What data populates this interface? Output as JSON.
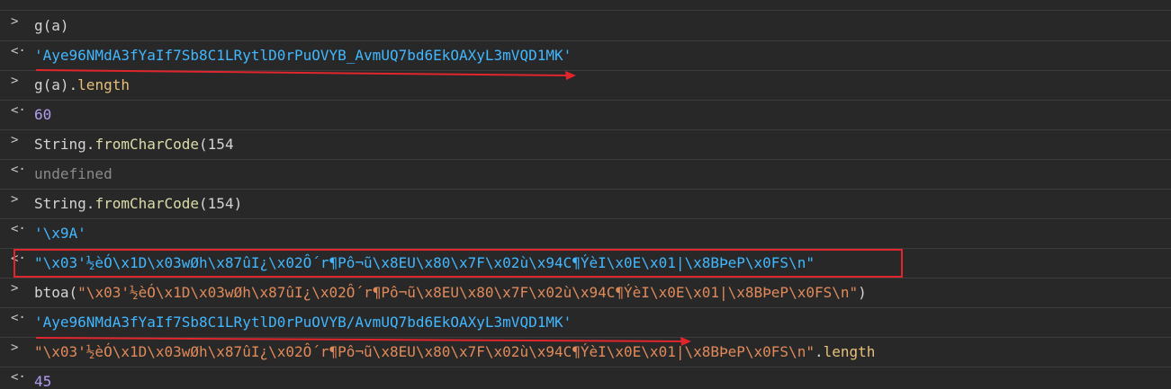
{
  "rows": [
    {
      "kind": "input",
      "parts": [
        {
          "t": "g(a)",
          "c": "plain"
        }
      ]
    },
    {
      "kind": "output",
      "parts": [
        {
          "t": "'Aye96NMdA3fYaIf7Sb8C1LRytlD0rPuOVYB_AvmUQ7bd6EkOAXyL3mVQD1MK'",
          "c": "strblue"
        }
      ]
    },
    {
      "kind": "input",
      "parts": [
        {
          "t": "g(a).",
          "c": "plain"
        },
        {
          "t": "length",
          "c": "prop"
        }
      ]
    },
    {
      "kind": "output",
      "parts": [
        {
          "t": "60",
          "c": "num"
        }
      ]
    },
    {
      "kind": "input",
      "parts": [
        {
          "t": "String.",
          "c": "plain"
        },
        {
          "t": "fromCharCode",
          "c": "fn"
        },
        {
          "t": "(",
          "c": "plain"
        },
        {
          "t": "154",
          "c": "plain"
        }
      ]
    },
    {
      "kind": "output",
      "parts": [
        {
          "t": "undefined",
          "c": "undef"
        }
      ]
    },
    {
      "kind": "input",
      "parts": [
        {
          "t": "String.",
          "c": "plain"
        },
        {
          "t": "fromCharCode",
          "c": "fn"
        },
        {
          "t": "(",
          "c": "plain"
        },
        {
          "t": "154",
          "c": "plain"
        },
        {
          "t": ")",
          "c": "plain"
        }
      ]
    },
    {
      "kind": "output",
      "parts": [
        {
          "t": "'\\x9A'",
          "c": "strblue"
        }
      ]
    },
    {
      "kind": "output",
      "parts": [
        {
          "t": "\"\\x03'½èÓ\\x1D\\x03wØh\\x87ûI¿\\x02Ô´r¶Pô¬ũ\\x8EU\\x80\\x7F\\x02ù\\x94C¶ÝèI\\x0E\\x01|\\x8BÞeP\\x0FS\\n\"",
          "c": "strblue"
        }
      ]
    },
    {
      "kind": "input",
      "parts": [
        {
          "t": "btoa(",
          "c": "plain"
        },
        {
          "t": "\"\\x03'½èÓ\\x1D\\x03wØh\\x87ûI¿\\x02Ô´r¶Pô¬ũ\\x8EU\\x80\\x7F\\x02ù\\x94C¶ÝèI\\x0E\\x01|\\x8BÞeP\\x0FS\\n\"",
          "c": "strorange"
        },
        {
          "t": ")",
          "c": "plain"
        }
      ]
    },
    {
      "kind": "output",
      "parts": [
        {
          "t": "'Aye96NMdA3fYaIf7Sb8C1LRytlD0rPuOVYB/AvmUQ7bd6EkOAXyL3mVQD1MK'",
          "c": "strblue"
        }
      ]
    },
    {
      "kind": "input",
      "parts": [
        {
          "t": "\"\\x03'½èÓ\\x1D\\x03wØh\\x87ûI¿\\x02Ô´r¶Pô¬ũ\\x8EU\\x80\\x7F\\x02ù\\x94C¶ÝèI\\x0E\\x01|\\x8BÞeP\\x0FS\\n\"",
          "c": "strorange"
        },
        {
          "t": ".",
          "c": "plain"
        },
        {
          "t": "length",
          "c": "prop"
        }
      ]
    },
    {
      "kind": "output",
      "parts": [
        {
          "t": "45",
          "c": "num"
        }
      ]
    }
  ],
  "glyphs": {
    "input": ">",
    "output": "<·"
  },
  "annotation_color": "#e0252c"
}
